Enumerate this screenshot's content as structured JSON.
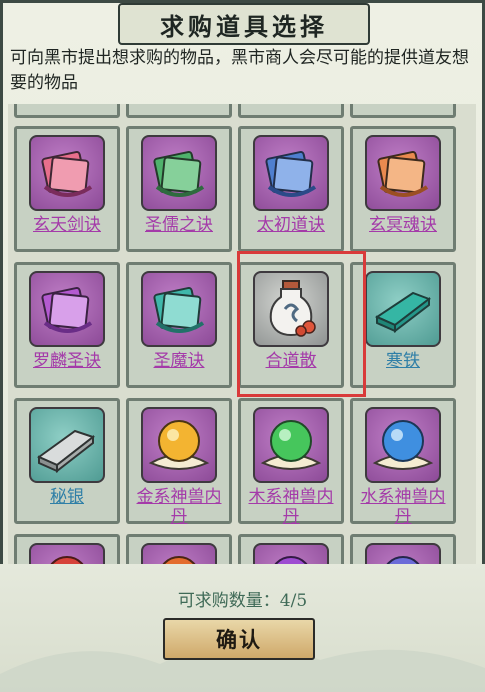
{
  "title": "求购道具选择",
  "description": "可向黑市提出想求购的物品，黑市商人会尽可能的提供道友想要的物品",
  "items": [
    {
      "label": "玄天剑诀",
      "icon": "book-stack-icon",
      "bg": "purple",
      "label_color": "purple"
    },
    {
      "label": "圣儒之诀",
      "icon": "book-stack-icon",
      "bg": "purple",
      "label_color": "purple"
    },
    {
      "label": "太初道诀",
      "icon": "book-stack-icon",
      "bg": "purple",
      "label_color": "purple"
    },
    {
      "label": "玄冥魂诀",
      "icon": "book-stack-icon",
      "bg": "purple",
      "label_color": "purple"
    },
    {
      "label": "罗麟圣诀",
      "icon": "book-stack-icon",
      "bg": "purple",
      "label_color": "purple"
    },
    {
      "label": "圣魔诀",
      "icon": "book-stack-icon",
      "bg": "purple",
      "label_color": "purple"
    },
    {
      "label": "合道散",
      "icon": "potion-bottle-icon",
      "bg": "gray",
      "label_color": "purple",
      "selected": true
    },
    {
      "label": "寒铁",
      "icon": "teal-ingot-icon",
      "bg": "teal",
      "label_color": "blue"
    },
    {
      "label": "秘银",
      "icon": "silver-ingot-icon",
      "bg": "teal",
      "label_color": "blue"
    },
    {
      "label": "金系神兽内丹",
      "icon": "gold-orb-icon",
      "bg": "purple",
      "label_color": "purple"
    },
    {
      "label": "木系神兽内丹",
      "icon": "green-orb-icon",
      "bg": "purple",
      "label_color": "purple"
    },
    {
      "label": "水系神兽内丹",
      "icon": "blue-orb-icon",
      "bg": "purple",
      "label_color": "purple"
    }
  ],
  "count_text": "可求购数量：4/5",
  "confirm_label": "确认",
  "colors": {
    "selection": "#d93a3a",
    "purple_label": "#a43aa9",
    "blue_label": "#2f7fa7"
  }
}
